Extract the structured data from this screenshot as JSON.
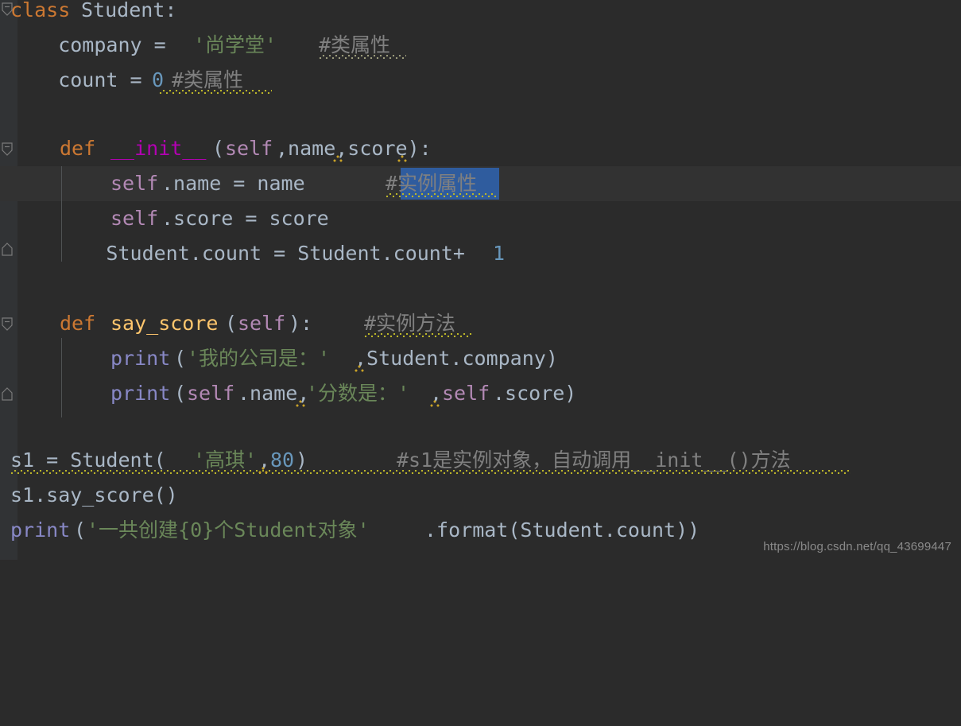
{
  "editor": {
    "theme_name": "darcula",
    "colors": {
      "background": "#2b2b2b",
      "gutter": "#313335",
      "current_line": "#323232",
      "default_text": "#a9b7c6",
      "keyword": "#cc7832",
      "string": "#6a8759",
      "comment": "#808080",
      "number": "#6897bb",
      "self_param": "#b389b5",
      "magic_method": "#b200b2",
      "function_def": "#ffc66d",
      "builtin_function": "#8888c6",
      "selection": "#2f5c9e",
      "warning_squiggle": "#bbb529",
      "indent_guide": "#4f5254"
    }
  },
  "code_lines": [
    {
      "index": 0,
      "tokens": [
        {
          "text": "class",
          "kind": "keyword"
        },
        {
          "text": " ",
          "kind": "default"
        },
        {
          "text": "Student:",
          "kind": "default"
        }
      ]
    },
    {
      "index": 1,
      "tokens": [
        {
          "text": "    company = ",
          "kind": "default"
        },
        {
          "text": "'尚学堂'",
          "kind": "string"
        },
        {
          "text": "    ",
          "kind": "default"
        },
        {
          "text": "#类属性",
          "kind": "comment"
        }
      ]
    },
    {
      "index": 2,
      "tokens": [
        {
          "text": "    count = ",
          "kind": "default"
        },
        {
          "text": "0",
          "kind": "number"
        },
        {
          "text": " ",
          "kind": "default"
        },
        {
          "text": "#类属性",
          "kind": "comment"
        }
      ]
    },
    {
      "index": 3,
      "tokens": []
    },
    {
      "index": 4,
      "tokens": [
        {
          "text": "    ",
          "kind": "default"
        },
        {
          "text": "def",
          "kind": "keyword"
        },
        {
          "text": " ",
          "kind": "default"
        },
        {
          "text": "__init__",
          "kind": "magic"
        },
        {
          "text": "(",
          "kind": "default"
        },
        {
          "text": "self",
          "kind": "self"
        },
        {
          "text": ",name,score):",
          "kind": "default"
        }
      ]
    },
    {
      "index": 5,
      "tokens": [
        {
          "text": "        ",
          "kind": "default"
        },
        {
          "text": "self",
          "kind": "self"
        },
        {
          "text": ".name = name",
          "kind": "default"
        },
        {
          "text": "      ",
          "kind": "default"
        },
        {
          "text": "#实例属性",
          "kind": "comment"
        }
      ]
    },
    {
      "index": 6,
      "tokens": [
        {
          "text": "        ",
          "kind": "default"
        },
        {
          "text": "self",
          "kind": "self"
        },
        {
          "text": ".score = score",
          "kind": "default"
        }
      ]
    },
    {
      "index": 7,
      "tokens": [
        {
          "text": "        Student.count = Student.count+",
          "kind": "default"
        },
        {
          "text": "1",
          "kind": "number"
        }
      ]
    },
    {
      "index": 8,
      "tokens": []
    },
    {
      "index": 9,
      "tokens": [
        {
          "text": "    ",
          "kind": "default"
        },
        {
          "text": "def",
          "kind": "keyword"
        },
        {
          "text": " ",
          "kind": "default"
        },
        {
          "text": "say_score",
          "kind": "funcdef"
        },
        {
          "text": "(",
          "kind": "default"
        },
        {
          "text": "self",
          "kind": "self"
        },
        {
          "text": "):",
          "kind": "default"
        },
        {
          "text": "    ",
          "kind": "default"
        },
        {
          "text": "#实例方法",
          "kind": "comment"
        }
      ]
    },
    {
      "index": 10,
      "tokens": [
        {
          "text": "        ",
          "kind": "default"
        },
        {
          "text": "print",
          "kind": "builtin"
        },
        {
          "text": "(",
          "kind": "default"
        },
        {
          "text": "'我的公司是：'",
          "kind": "string"
        },
        {
          "text": ",Student.company)",
          "kind": "default"
        }
      ]
    },
    {
      "index": 11,
      "tokens": [
        {
          "text": "        ",
          "kind": "default"
        },
        {
          "text": "print",
          "kind": "builtin"
        },
        {
          "text": "(",
          "kind": "default"
        },
        {
          "text": "self",
          "kind": "self"
        },
        {
          "text": ".name,",
          "kind": "default"
        },
        {
          "text": "'分数是：'",
          "kind": "string"
        },
        {
          "text": ",",
          "kind": "default"
        },
        {
          "text": "self",
          "kind": "self"
        },
        {
          "text": ".score)",
          "kind": "default"
        }
      ]
    },
    {
      "index": 12,
      "tokens": []
    },
    {
      "index": 13,
      "tokens": [
        {
          "text": "s1 = Student(",
          "kind": "default"
        },
        {
          "text": "'高琪'",
          "kind": "string"
        },
        {
          "text": ",",
          "kind": "default"
        },
        {
          "text": "80",
          "kind": "number"
        },
        {
          "text": ")",
          "kind": "default"
        },
        {
          "text": "       ",
          "kind": "default"
        },
        {
          "text": "#s1是实例对象，自动调用__init__()方法",
          "kind": "comment"
        }
      ]
    },
    {
      "index": 14,
      "tokens": [
        {
          "text": "s1.say_score()",
          "kind": "default"
        }
      ]
    },
    {
      "index": 15,
      "tokens": [
        {
          "text": "print",
          "kind": "builtin"
        },
        {
          "text": "(",
          "kind": "default"
        },
        {
          "text": "'一共创建{0}个Student对象'",
          "kind": "string"
        },
        {
          "text": ".format(Student.count))",
          "kind": "default"
        }
      ]
    }
  ],
  "selection": {
    "text": "实例属性",
    "line_index": 5
  },
  "gutter": {
    "markers": [
      {
        "name": "fold-expanded-class",
        "type": "expanded",
        "line_index": 0
      },
      {
        "name": "fold-expanded-init",
        "type": "expanded",
        "line_index": 4
      },
      {
        "name": "fold-end-init",
        "type": "end",
        "line_index": 7
      },
      {
        "name": "fold-expanded-say-score",
        "type": "expanded",
        "line_index": 9
      },
      {
        "name": "fold-end-say-score",
        "type": "end",
        "line_index": 11
      }
    ]
  },
  "watermark": {
    "text": "https://blog.csdn.net/qq_43699447"
  }
}
